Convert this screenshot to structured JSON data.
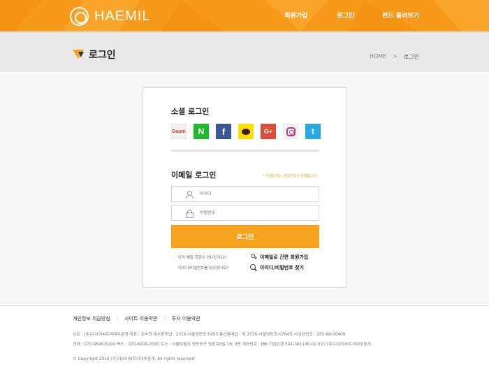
{
  "header": {
    "logo_text": "HAEMIL",
    "nav": [
      "회원가입",
      "로그인",
      "펀드 둘러보기"
    ],
    "color": "#f79a1c"
  },
  "subheader": {
    "title": "로그인",
    "breadcrumb": [
      "HOME",
      ">",
      "로그인"
    ]
  },
  "social": {
    "title": "소셜 로그인",
    "providers": [
      {
        "icon": "daum-icon",
        "glyph": "Daum"
      },
      {
        "icon": "naver-icon",
        "glyph": "N"
      },
      {
        "icon": "facebook-icon",
        "glyph": "f"
      },
      {
        "icon": "kakao-icon",
        "glyph": ""
      },
      {
        "icon": "google-plus-icon",
        "glyph": "G+"
      },
      {
        "icon": "instagram-icon",
        "glyph": ""
      },
      {
        "icon": "twitter-icon",
        "glyph": "t"
      }
    ]
  },
  "email_login": {
    "title": "이메일 로그인",
    "notice": "* 이메일 또는 비밀번호가 틀렸습니다.",
    "id_placeholder": "아이디",
    "pw_placeholder": "비밀번호",
    "button": "로그인"
  },
  "help": {
    "q1": "아직 해밀 회원이 아니신가요?",
    "link1": "이메일로 간편 회원가입",
    "q2": "아이디/비밀번호를 잊으셨나요?",
    "link2": "아이디/비밀번호 찾기"
  },
  "footer": {
    "links": [
      "개인정보 취급방침",
      "사이트 이용약관",
      "투자 이용약관"
    ],
    "line1": "상호 : (주)디브이씨트리대부중개     대표 : 김숙희     대부중개업 : 2016-서울영등포-0853     통신판매업 : 제 2016-서울영등포-0764호     사업자번호 : 283-88-00409",
    "line2": "전화 : 070-4640-6194     팩스 : 070-4009-2030     주소 : 서울특별시 영등포구 영중로6길 16, 3층     계좌번호 : IBK 기업은행 541-041146-01-010 (주)디브이씨트리대부중개",
    "copyright": "© Copyright 2016 (주)디브이씨트리대부중개. All rights reserved"
  }
}
